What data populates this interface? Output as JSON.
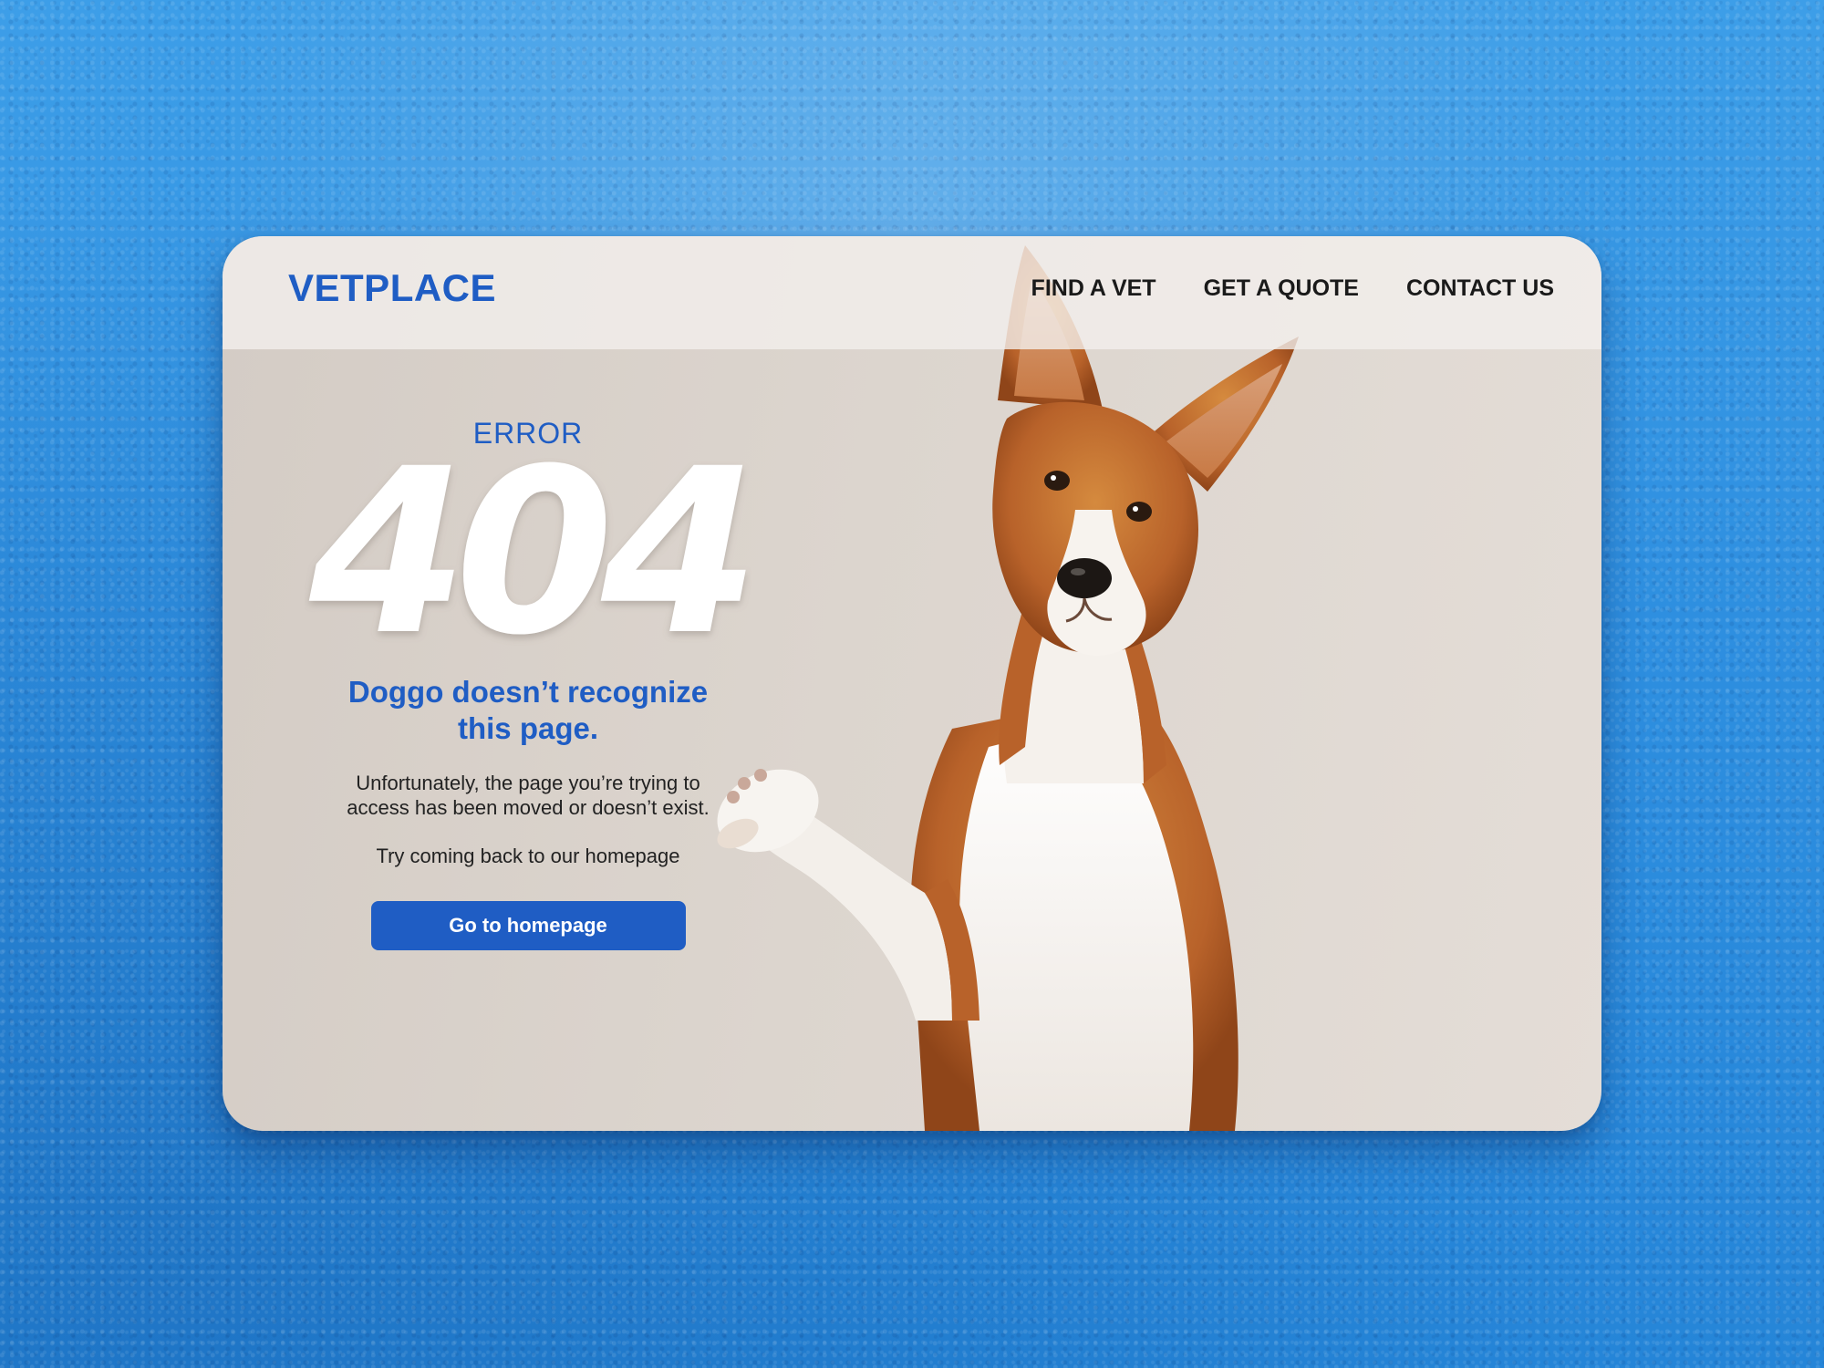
{
  "brand": {
    "name": "VETPLACE",
    "color": "#1f5dc4"
  },
  "nav": {
    "items": [
      {
        "label": "FIND A VET"
      },
      {
        "label": "GET A QUOTE"
      },
      {
        "label": "CONTACT US"
      }
    ]
  },
  "error": {
    "label": "ERROR",
    "code": "404",
    "headline": "Doggo doesn’t recognize this page.",
    "message": "Unfortunately, the page you’re trying to access has been moved or doesn’t exist.",
    "hint": "Try coming back to our homepage"
  },
  "cta": {
    "label": "Go to homepage"
  },
  "colors": {
    "accent": "#1f5dc4",
    "background": "#2e8fe0",
    "card": "#dcd5ce",
    "nav_text": "#1a1a1a"
  },
  "icons": {
    "hero_image": "dog-raising-paw"
  }
}
